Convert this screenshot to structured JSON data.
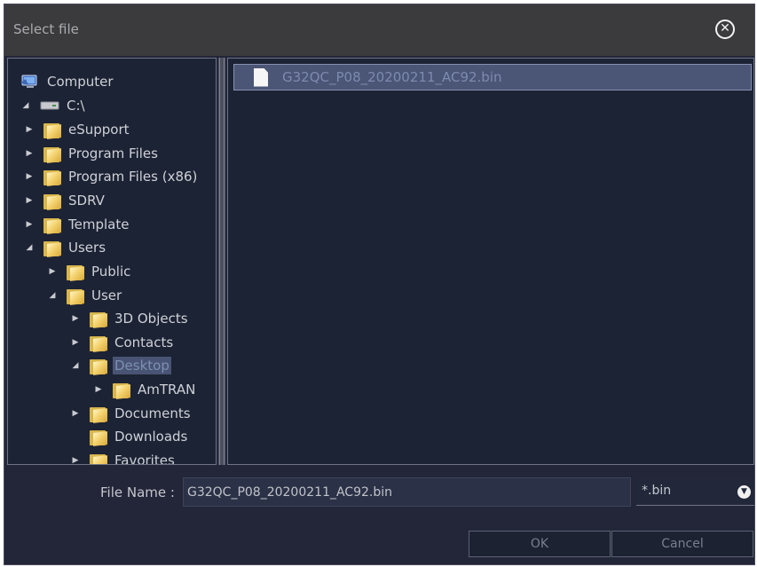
{
  "dialog": {
    "title": "Select file",
    "close_icon": "close-circle-icon"
  },
  "tree": [
    {
      "label": "Computer",
      "icon": "computer-icon",
      "expander": "none",
      "depth": 0
    },
    {
      "label": "C:\\",
      "icon": "drive-icon",
      "expander": "expanded",
      "depth": 0
    },
    {
      "label": "eSupport",
      "icon": "folder-icon",
      "expander": "collapsed",
      "depth": 1
    },
    {
      "label": "Program Files",
      "icon": "folder-icon",
      "expander": "collapsed",
      "depth": 1
    },
    {
      "label": "Program Files (x86)",
      "icon": "folder-icon",
      "expander": "collapsed",
      "depth": 1
    },
    {
      "label": "SDRV",
      "icon": "folder-icon",
      "expander": "collapsed",
      "depth": 1
    },
    {
      "label": "Template",
      "icon": "folder-icon",
      "expander": "collapsed",
      "depth": 1
    },
    {
      "label": "Users",
      "icon": "folder-icon",
      "expander": "expanded",
      "depth": 1
    },
    {
      "label": "Public",
      "icon": "folder-icon",
      "expander": "collapsed",
      "depth": 2
    },
    {
      "label": "User",
      "icon": "folder-icon",
      "expander": "expanded",
      "depth": 2
    },
    {
      "label": "3D Objects",
      "icon": "folder-icon",
      "expander": "collapsed",
      "depth": 3
    },
    {
      "label": "Contacts",
      "icon": "folder-icon",
      "expander": "collapsed",
      "depth": 3
    },
    {
      "label": "Desktop",
      "icon": "folder-icon",
      "expander": "expanded",
      "depth": 3,
      "selected": true
    },
    {
      "label": "AmTRAN",
      "icon": "folder-icon",
      "expander": "collapsed",
      "depth": 4
    },
    {
      "label": "Documents",
      "icon": "folder-icon",
      "expander": "collapsed",
      "depth": 3
    },
    {
      "label": "Downloads",
      "icon": "folder-icon",
      "expander": "none",
      "depth": 3
    },
    {
      "label": "Favorites",
      "icon": "folder-icon",
      "expander": "collapsed",
      "depth": 3
    }
  ],
  "files": [
    {
      "name": "G32QC_P08_20200211_AC92.bin",
      "icon": "file-icon",
      "selected": true
    }
  ],
  "footer": {
    "file_name_label": "File Name :",
    "file_name_value": "G32QC_P08_20200211_AC92.bin",
    "filter_value": "*.bin",
    "filter_icon": "chevron-down-circle-icon",
    "ok_label": "OK",
    "cancel_label": "Cancel"
  }
}
